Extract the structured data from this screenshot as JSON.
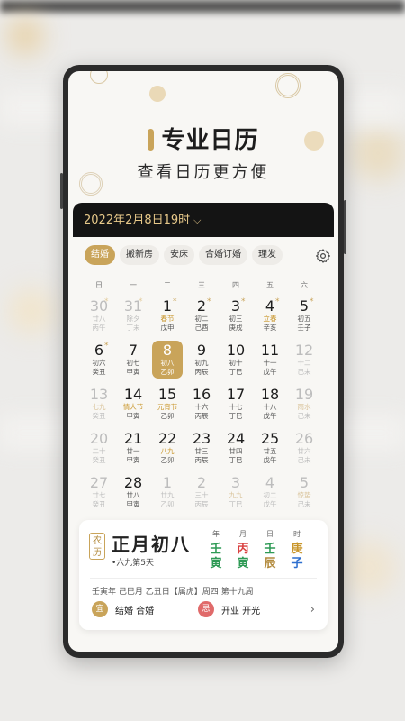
{
  "header": {
    "title": "专业日历",
    "subtitle": "查看日历更方便"
  },
  "colors": {
    "accent_gold": "#c9a45a",
    "dark_bar": "#141414",
    "yi_green": "#c9a45a",
    "ji_red": "#e06a6a"
  },
  "calendar": {
    "date_selector": "2022年2月8日19时",
    "selector_icon": "chevron-down-icon",
    "tabs": [
      "结婚",
      "搬新房",
      "安床",
      "合婚订婚",
      "理发"
    ],
    "active_tab": "结婚",
    "settings_icon": "gear-icon",
    "weekdays": [
      "日",
      "一",
      "二",
      "三",
      "四",
      "五",
      "六"
    ],
    "weeks": [
      [
        {
          "d": "30",
          "l1": "廿八",
          "l2": "丙午",
          "other": true,
          "star": true
        },
        {
          "d": "31",
          "l1": "除夕",
          "l2": "丁未",
          "other": true,
          "star": true
        },
        {
          "d": "1",
          "l1": "春节",
          "l2": "戊申",
          "star": true,
          "hl": true
        },
        {
          "d": "2",
          "l1": "初二",
          "l2": "己酉",
          "star": true
        },
        {
          "d": "3",
          "l1": "初三",
          "l2": "庚戌",
          "star": true
        },
        {
          "d": "4",
          "l1": "立春",
          "l2": "辛亥",
          "star": true,
          "hl": true
        },
        {
          "d": "5",
          "l1": "初五",
          "l2": "壬子",
          "star": true
        }
      ],
      [
        {
          "d": "6",
          "l1": "初六",
          "l2": "癸丑",
          "star": true
        },
        {
          "d": "7",
          "l1": "初七",
          "l2": "甲寅"
        },
        {
          "d": "8",
          "l1": "初八",
          "l2": "乙卯",
          "today": true
        },
        {
          "d": "9",
          "l1": "初九",
          "l2": "丙辰"
        },
        {
          "d": "10",
          "l1": "初十",
          "l2": "丁巳"
        },
        {
          "d": "11",
          "l1": "十一",
          "l2": "戊午"
        },
        {
          "d": "12",
          "l1": "十二",
          "l2": "己未",
          "other": true
        }
      ],
      [
        {
          "d": "13",
          "l1": "七九",
          "l2": "癸丑",
          "other": true,
          "hl": true
        },
        {
          "d": "14",
          "l1": "情人节",
          "l2": "甲寅",
          "hl": true
        },
        {
          "d": "15",
          "l1": "元宵节",
          "l2": "乙卯",
          "hl": true
        },
        {
          "d": "16",
          "l1": "十六",
          "l2": "丙辰"
        },
        {
          "d": "17",
          "l1": "十七",
          "l2": "丁巳"
        },
        {
          "d": "18",
          "l1": "十八",
          "l2": "戊午"
        },
        {
          "d": "19",
          "l1": "雨水",
          "l2": "己未",
          "other": true,
          "hl": true
        }
      ],
      [
        {
          "d": "20",
          "l1": "二十",
          "l2": "癸丑",
          "other": true
        },
        {
          "d": "21",
          "l1": "廿一",
          "l2": "甲寅"
        },
        {
          "d": "22",
          "l1": "八九",
          "l2": "乙卯",
          "hl": true
        },
        {
          "d": "23",
          "l1": "廿三",
          "l2": "丙辰"
        },
        {
          "d": "24",
          "l1": "廿四",
          "l2": "丁巳"
        },
        {
          "d": "25",
          "l1": "廿五",
          "l2": "戊午"
        },
        {
          "d": "26",
          "l1": "廿六",
          "l2": "己未",
          "other": true
        }
      ],
      [
        {
          "d": "27",
          "l1": "廿七",
          "l2": "癸丑",
          "other": true
        },
        {
          "d": "28",
          "l1": "廿八",
          "l2": "甲寅"
        },
        {
          "d": "1",
          "l1": "廿九",
          "l2": "乙卯",
          "other": true
        },
        {
          "d": "2",
          "l1": "三十",
          "l2": "丙辰",
          "other": true
        },
        {
          "d": "3",
          "l1": "九九",
          "l2": "丁巳",
          "other": true,
          "hl": true
        },
        {
          "d": "4",
          "l1": "初二",
          "l2": "戊午",
          "other": true
        },
        {
          "d": "5",
          "l1": "惊蛰",
          "l2": "己未",
          "other": true,
          "hl": true
        }
      ]
    ]
  },
  "lunar_card": {
    "seal": "农历",
    "lunar_date": "正月初八",
    "sub": "•六九第5天",
    "ganzhi": [
      {
        "head": "年",
        "top": "壬",
        "bottom": "寅",
        "top_color": "#2e9a55",
        "bottom_color": "#2e9a55"
      },
      {
        "head": "月",
        "top": "丙",
        "bottom": "寅",
        "top_color": "#d94040",
        "bottom_color": "#2e9a55"
      },
      {
        "head": "日",
        "top": "壬",
        "bottom": "辰",
        "top_color": "#2e9a55",
        "bottom_color": "#b38b3e"
      },
      {
        "head": "时",
        "top": "庚",
        "bottom": "子",
        "top_color": "#c9962b",
        "bottom_color": "#2f6fcf"
      }
    ],
    "info": "壬寅年 己巳月 乙丑日【属虎】周四 第十九周",
    "yi_label": "宜",
    "yi_text": "结婚 合婚",
    "ji_label": "忌",
    "ji_text": "开业 开光",
    "arrow_icon": "chevron-right-icon"
  }
}
